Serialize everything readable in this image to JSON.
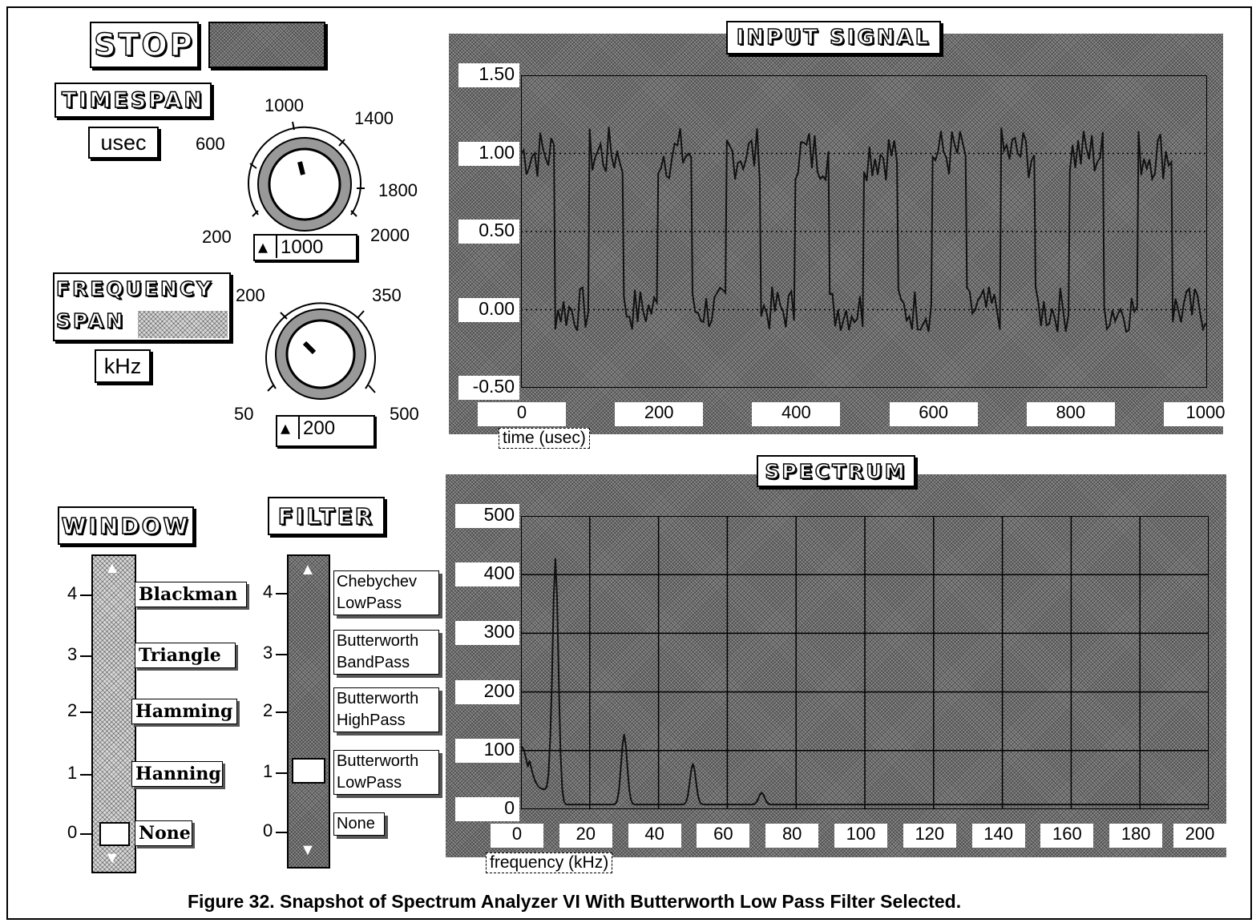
{
  "controls": {
    "stop_label": "STOP",
    "timespan": {
      "title": "TIMESPAN",
      "unit": "usec",
      "dial_labels": [
        "200",
        "600",
        "1000",
        "1400",
        "1800",
        "2000"
      ],
      "value": "1000"
    },
    "frequency_span": {
      "title_line1": "FREQUENCY",
      "title_line2": "SPAN",
      "unit": "kHz",
      "dial_labels": [
        "50",
        "200",
        "350",
        "500"
      ],
      "value": "200"
    },
    "window": {
      "title": "WINDOW",
      "ticks": [
        "4",
        "3",
        "2",
        "1",
        "0"
      ],
      "options": [
        "Blackman",
        "Triangle",
        "Hamming",
        "Hanning",
        "None"
      ],
      "selected": "None"
    },
    "filter": {
      "title": "FILTER",
      "ticks": [
        "4",
        "3",
        "2",
        "1",
        "0"
      ],
      "options": [
        {
          "line1": "Chebychev",
          "line2": "LowPass"
        },
        {
          "line1": "Butterworth",
          "line2": "BandPass"
        },
        {
          "line1": "Butterworth",
          "line2": "HighPass"
        },
        {
          "line1": "Butterworth",
          "line2": "LowPass"
        },
        {
          "line1": "None",
          "line2": ""
        }
      ],
      "selected": "Butterworth LowPass"
    }
  },
  "chart_data": [
    {
      "type": "line",
      "title": "INPUT SIGNAL",
      "xlabel": "time (usec)",
      "ylabel": "",
      "xlim": [
        0,
        1000
      ],
      "ylim": [
        -0.5,
        1.5
      ],
      "x_ticks": [
        "0",
        "200",
        "400",
        "600",
        "800",
        "1000"
      ],
      "y_ticks": [
        "1.50",
        "1.00",
        "0.50",
        "0.00",
        "-0.50"
      ],
      "grid": "dotted",
      "series": [
        {
          "description": "noisy square wave",
          "period_usec": 100,
          "high": 1.0,
          "low": 0.0,
          "cycles": 10
        }
      ]
    },
    {
      "type": "line",
      "title": "SPECTRUM",
      "xlabel": "frequency (kHz)",
      "ylabel": "",
      "xlim": [
        0,
        200
      ],
      "ylim": [
        0,
        500
      ],
      "x_ticks": [
        "0",
        "20",
        "40",
        "60",
        "80",
        "100",
        "120",
        "140",
        "160",
        "180",
        "200"
      ],
      "y_ticks": [
        "500",
        "400",
        "300",
        "200",
        "100",
        "0"
      ],
      "grid": "solid",
      "peaks": [
        {
          "x": 0,
          "y": 100
        },
        {
          "x": 10,
          "y": 420
        },
        {
          "x": 30,
          "y": 120
        },
        {
          "x": 50,
          "y": 70
        },
        {
          "x": 70,
          "y": 20
        }
      ]
    }
  ],
  "caption": "Figure 32.  Snapshot of Spectrum Analyzer VI With Butterworth Low Pass Filter Selected."
}
